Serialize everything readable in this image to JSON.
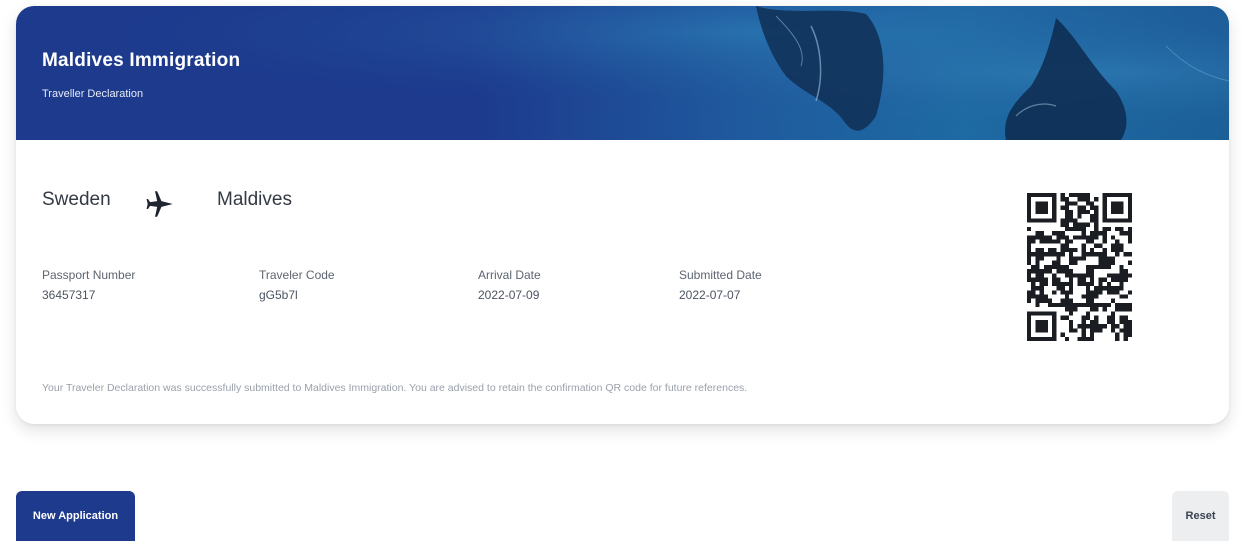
{
  "banner": {
    "title": "Maldives Immigration",
    "subtitle": "Traveller Declaration",
    "background_color": "#1d3a8d"
  },
  "route": {
    "origin": "Sweden",
    "destination": "Maldives",
    "icon": "airplane-icon"
  },
  "fields": [
    {
      "label": "Passport Number",
      "value": "36457317"
    },
    {
      "label": "Traveler Code",
      "value": "gG5b7l"
    },
    {
      "label": "Arrival Date",
      "value": "2022-07-09"
    },
    {
      "label": "Submitted Date",
      "value": "2022-07-07"
    }
  ],
  "message": "Your Traveler Declaration was successfully submitted to Maldives Immigration. You are advised to retain the confirmation QR code for future references.",
  "qr": {
    "icon": "qr-code-icon"
  },
  "actions": {
    "new_application": "New Application",
    "reset": "Reset"
  },
  "colors": {
    "primary": "#1d3a8d",
    "reset_bg": "#eceef0"
  }
}
